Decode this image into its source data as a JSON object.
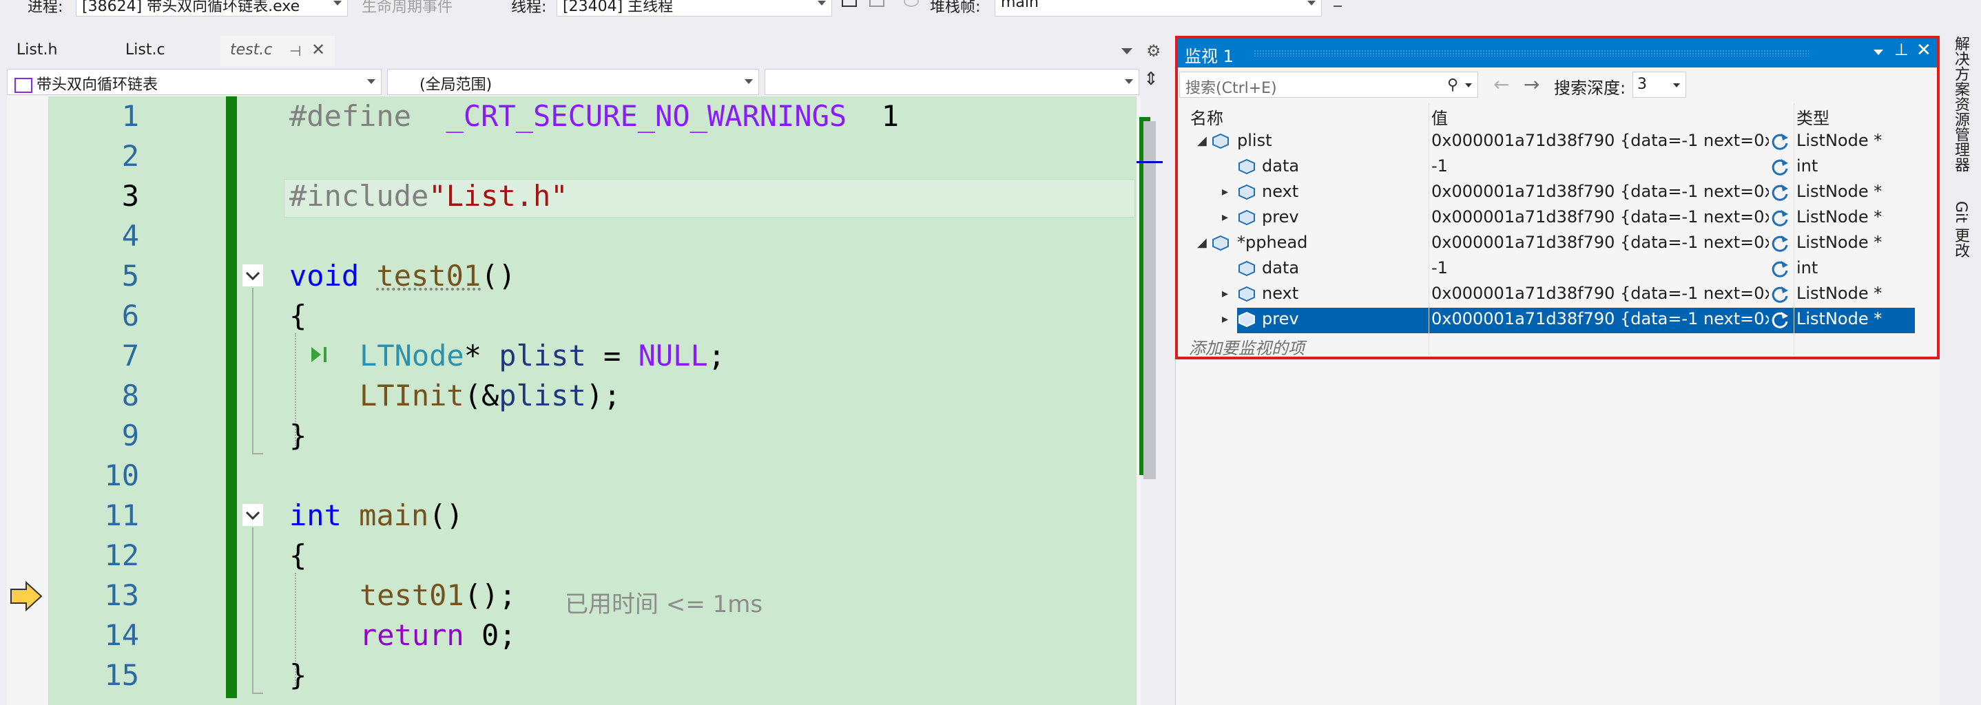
{
  "toolbar": {
    "process_label": "进程:",
    "process_value": "[38624] 带头双向循环链表.exe",
    "lifecycle_label": "生命周期事件",
    "thread_label": "线程:",
    "thread_value": "[23404] 主线程",
    "stackframe_label": "堆栈帧:",
    "stackframe_value": "main"
  },
  "tabs": [
    {
      "label": "List.h"
    },
    {
      "label": "List.c"
    },
    {
      "label": "test.c"
    }
  ],
  "nav": {
    "project": "带头双向循环链表",
    "scope": "(全局范围)",
    "member": ""
  },
  "editor": {
    "line_numbers": [
      "1",
      "2",
      "3",
      "4",
      "5",
      "6",
      "7",
      "8",
      "9",
      "10",
      "11",
      "12",
      "13",
      "14",
      "15"
    ],
    "l1": {
      "kw": "#define",
      "macro": "_CRT_SECURE_NO_WARNINGS",
      "val": "1"
    },
    "l3": {
      "kw": "#include",
      "str": "\"List.h\""
    },
    "l5": {
      "kw": "void",
      "fn": "test01",
      "rest": "()"
    },
    "l6": "{",
    "l7": {
      "type": "LTNode",
      "mid": "* ",
      "var": "plist",
      "eq": " = ",
      "null": "NULL",
      "end": ";"
    },
    "l8": {
      "fn": "LTInit",
      "open": "(&",
      "var": "plist",
      "end": ");"
    },
    "l9": "}",
    "l11": {
      "kw": "int",
      "fn": "main",
      "rest": "()"
    },
    "l12": "{",
    "l13": {
      "fn": "test01",
      "end": "();",
      "hint": "已用时间 <= 1ms"
    },
    "l14": {
      "kw": "return",
      "end": " 0;"
    },
    "l15": "}"
  },
  "watch": {
    "title": "监视 1",
    "search_placeholder": "搜索(Ctrl+E)",
    "depth_label": "搜索深度:",
    "depth_value": "3",
    "col_name": "名称",
    "col_value": "值",
    "col_type": "类型",
    "rows": [
      {
        "name": "plist",
        "value": "0x000001a71d38f790 {data=-1 next=0x0...",
        "type": "ListNode *"
      },
      {
        "name": "data",
        "value": "-1",
        "type": "int"
      },
      {
        "name": "next",
        "value": "0x000001a71d38f790 {data=-1 next=0x0...",
        "type": "ListNode *"
      },
      {
        "name": "prev",
        "value": "0x000001a71d38f790 {data=-1 next=0x0...",
        "type": "ListNode *"
      },
      {
        "name": "*pphead",
        "value": "0x000001a71d38f790 {data=-1 next=0x0...",
        "type": "ListNode *"
      },
      {
        "name": "data",
        "value": "-1",
        "type": "int"
      },
      {
        "name": "next",
        "value": "0x000001a71d38f790 {data=-1 next=0x0...",
        "type": "ListNode *"
      },
      {
        "name": "prev",
        "value": "0x000001a71d38f790 {data=-1 next=0x0...",
        "type": "ListNode *"
      }
    ],
    "add_item": "添加要监视的项"
  },
  "side_tabs": [
    "解决方案资源管理器",
    "Git 更改"
  ],
  "colors": {
    "accent": "#007acc",
    "selection": "#0063b1",
    "highlight_border": "#e01b1b",
    "editor_bg": "#cce8cf"
  }
}
